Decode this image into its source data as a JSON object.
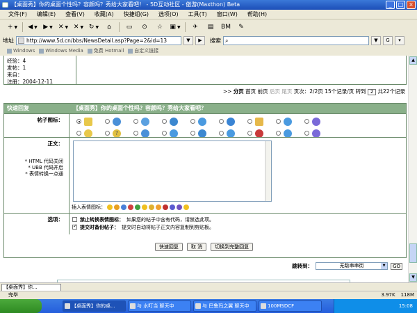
{
  "window": {
    "title": "【桌面秀】你的桌面个性吗？容颜吗？秀给大家看吧！ - 5D互动社区 - 傲游(Maxthon) Beta"
  },
  "menu": [
    "文件(F)",
    "编辑(E)",
    "查看(V)",
    "收藏(A)",
    "快捷组(G)",
    "选项(O)",
    "工具(T)",
    "窗口(W)",
    "帮助(H)"
  ],
  "address": {
    "label": "地址",
    "url": "http://www.5d.cn/bbs/NewsDetail.asp?Page=2&id=13",
    "search_label": "搜索"
  },
  "links": [
    "Windows",
    "Windows Media",
    "免费 Hotmail",
    "自定义链接"
  ],
  "user": {
    "lines": [
      "经验：4",
      "发帖：1",
      "来自：",
      "注册：2004-12-11"
    ]
  },
  "pager": {
    "label": "分页",
    "first": "首页",
    "prev": "前页",
    "next": "后页",
    "last": "尾页",
    "info": "页次：2/2页",
    "count": "15个记录/页",
    "goto": "转到",
    "page": "2",
    "total": "共22个记录"
  },
  "reply": {
    "header_left": "快速回复",
    "header_title": "【桌面秀】你的桌面个性吗？容颜吗？秀给大家看吧？",
    "icon_label": "帖子图标：",
    "body_label": "正文：",
    "notes": [
      "* HTML 代码关闭",
      "* UBB 代码开启",
      "* 表情转换一点通"
    ],
    "emote_label": "插入表情图标：",
    "options_label": "选项：",
    "opt1_bold": "禁止转换表情图标：",
    "opt1": "如果您的帖子中含有代码，请禁选此项。",
    "opt2_bold": "提交时备份帖子：",
    "opt2": "提交时自动将帖子正文内容复制到剪贴板。"
  },
  "buttons": {
    "quick": "快速回复",
    "cancel": "取 消",
    "full": "切换到完整回复"
  },
  "jump": {
    "label": "跳转到：",
    "value": "无敌串串街",
    "go": "GO"
  },
  "doctab": "【桌面秀】你...",
  "status": {
    "text": "完毕",
    "speed": "3.97K",
    "mem": "118M"
  },
  "taskbar": {
    "tasks": [
      "【桌面秀】你的桌...",
      "与 水叮当 聊天中",
      "与 巴鲁玛之翼 聊天中",
      "100MSDCF"
    ],
    "clock": "15:08"
  },
  "colors": {
    "header_green": "#8ab08a",
    "border_green": "#6a8a6a"
  }
}
